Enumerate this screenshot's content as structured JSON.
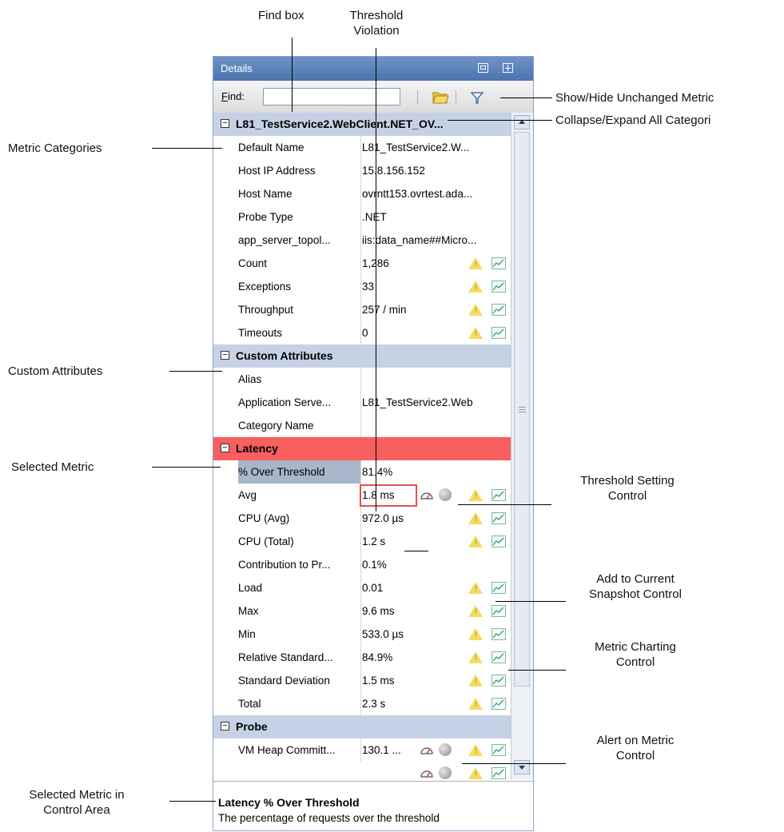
{
  "annotations": {
    "find_box": "Find box",
    "threshold_violation": [
      "Threshold",
      "Violation"
    ],
    "show_hide_unchanged": "Show/Hide Unchanged Metric",
    "collapse_expand_all": "Collapse/Expand All Categori",
    "metric_categories": "Metric Categories",
    "custom_attributes": "Custom Attributes",
    "selected_metric": "Selected Metric",
    "threshold_setting_control": [
      "Threshold Setting",
      "Control"
    ],
    "add_to_snapshot": [
      "Add to Current",
      "Snapshot Control"
    ],
    "metric_charting": [
      "Metric Charting",
      "Control"
    ],
    "alert_on_metric": [
      "Alert on Metric",
      "Control"
    ],
    "selected_metric_control_area": [
      "Selected Metric in",
      "Control Area"
    ]
  },
  "panel": {
    "title": "Details",
    "find_label_u": "F",
    "find_label_rest": "ind:",
    "find_value": "",
    "categories": [
      {
        "label": "L81_TestService2.WebClient.NET_OV...",
        "rows": [
          {
            "name": "Default Name",
            "value": "L81_TestService2.W..."
          },
          {
            "name": "Host IP Address",
            "value": "15.8.156.152"
          },
          {
            "name": "Host Name",
            "value": "ovrntt153.ovrtest.ada..."
          },
          {
            "name": "Probe Type",
            "value": ".NET"
          },
          {
            "name": "app_server_topol...",
            "value": "iis:data_name##Micro..."
          },
          {
            "name": "Count",
            "value": "1,286"
          },
          {
            "name": "Exceptions",
            "value": "33"
          },
          {
            "name": "Throughput",
            "value": "257 / min"
          },
          {
            "name": "Timeouts",
            "value": "0"
          }
        ]
      },
      {
        "label": "Custom Attributes",
        "rows": [
          {
            "name": "Alias",
            "value": ""
          },
          {
            "name": "Application Serve...",
            "value": "L81_TestService2.Web"
          },
          {
            "name": "Category Name",
            "value": ""
          }
        ]
      },
      {
        "label": "Latency",
        "rows": [
          {
            "name": "% Over Threshold",
            "value": "81.4%"
          },
          {
            "name": "Avg",
            "value": "1.8 ms"
          },
          {
            "name": "CPU (Avg)",
            "value": "972.0 µs"
          },
          {
            "name": "CPU (Total)",
            "value": "1.2 s"
          },
          {
            "name": "Contribution to Pr...",
            "value": "0.1%"
          },
          {
            "name": "Load",
            "value": "0.01"
          },
          {
            "name": "Max",
            "value": "9.6 ms"
          },
          {
            "name": "Min",
            "value": "533.0 µs"
          },
          {
            "name": "Relative Standard...",
            "value": "84.9%"
          },
          {
            "name": "Standard Deviation",
            "value": "1.5 ms"
          },
          {
            "name": "Total",
            "value": "2.3 s"
          }
        ]
      },
      {
        "label": "Probe",
        "rows": [
          {
            "name": "VM Heap Committ...",
            "value": "130.1 ..."
          }
        ]
      }
    ],
    "control_area": {
      "title": "Latency % Over Threshold",
      "description": "The percentage of requests over the threshold"
    }
  }
}
